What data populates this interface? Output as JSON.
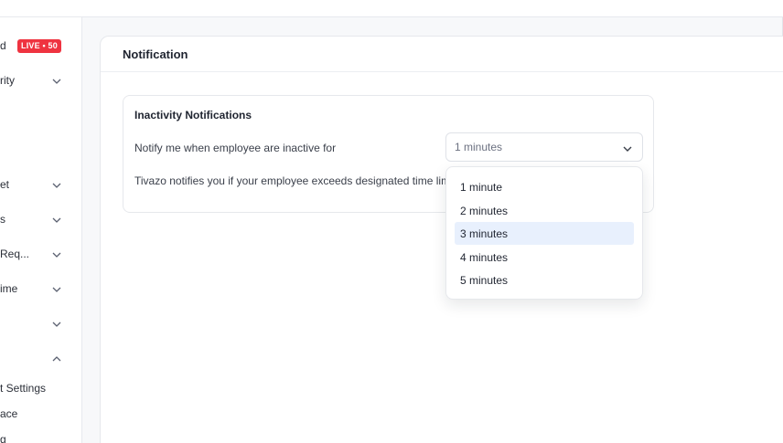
{
  "sidebar": {
    "dashboard": {
      "label": "d",
      "badge": "LIVE • 50"
    },
    "items": [
      {
        "label": "rity"
      },
      {
        "label": "et"
      },
      {
        "label": "s"
      },
      {
        "label": "Req..."
      },
      {
        "label": "ime"
      },
      {
        "label": ""
      },
      {
        "label": ""
      }
    ],
    "sub_items": [
      {
        "label": "t Settings"
      },
      {
        "label": "ace"
      },
      {
        "label": "g"
      }
    ]
  },
  "main": {
    "title": "Notification"
  },
  "panel": {
    "title": "Inactivity Notifications",
    "label": "Notify me when employee are inactive for",
    "help": "Tivazo notifies you if your employee exceeds designated time limits"
  },
  "select": {
    "value": "1 minutes",
    "expanded": true,
    "options": [
      {
        "label": "1 minute"
      },
      {
        "label": "2 minutes"
      },
      {
        "label": "3 minutes",
        "highlighted": true
      },
      {
        "label": "4 minutes"
      },
      {
        "label": "5 minutes"
      }
    ]
  },
  "colors": {
    "live_badge": "#ef3340",
    "option_highlight": "#e8f0fd",
    "border": "#e6e8ec"
  }
}
